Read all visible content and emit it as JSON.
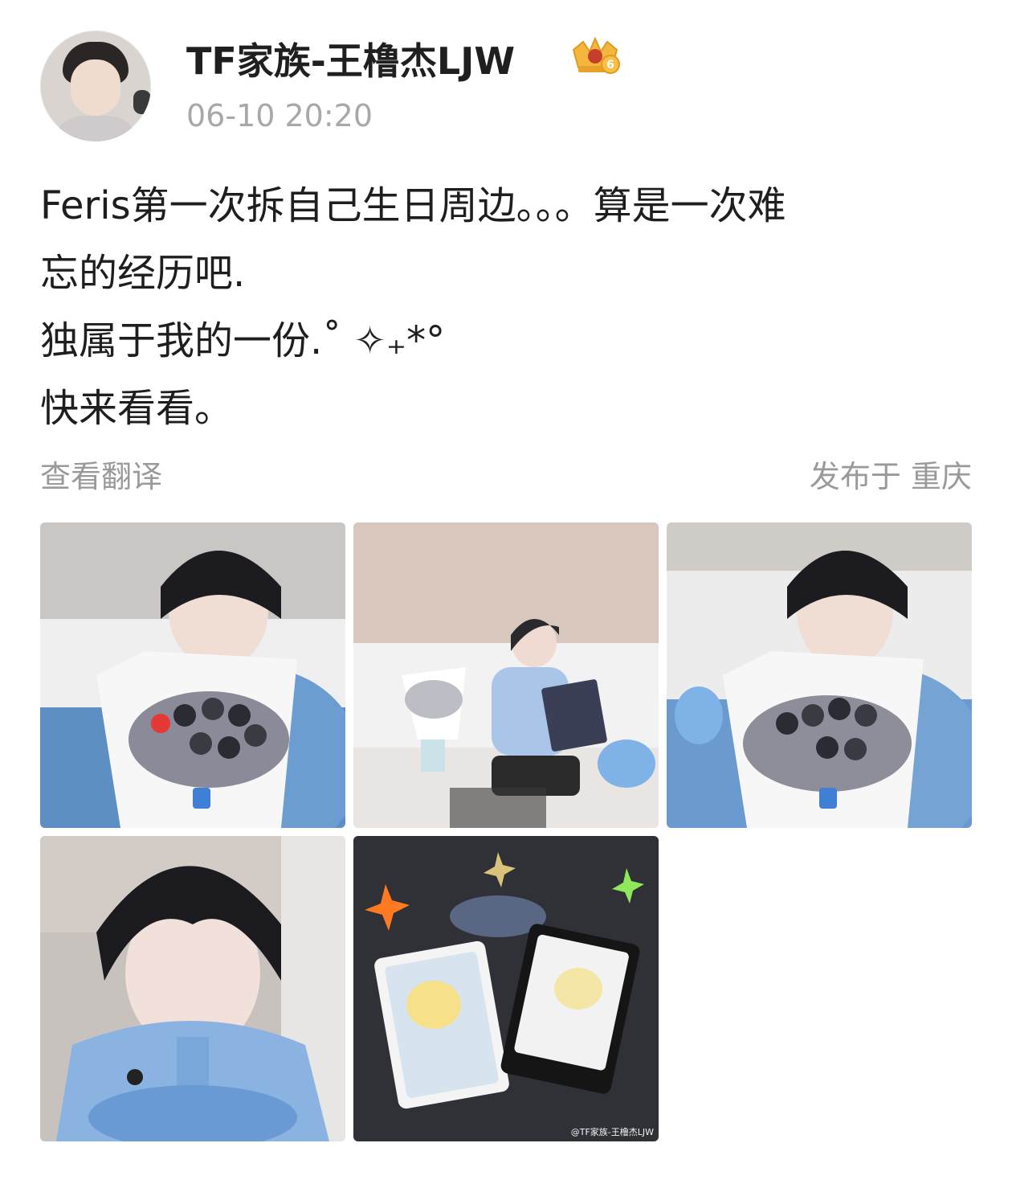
{
  "post": {
    "username": "TF家族-王橹杰LJW",
    "badge_icon": "crown-level-badge-icon",
    "badge_level": "6",
    "timestamp": "06-10 20:20",
    "text_lines": [
      "Feris第一次拆自己生日周边。。。算是一次难",
      "忘的经历吧.",
      "独属于我的一份.˚ ✧₊*°",
      "快来看看。"
    ],
    "translate_label": "查看翻译",
    "location_label": "发布于 重庆",
    "images": [
      {
        "name": "photo-bouquet-closeup"
      },
      {
        "name": "photo-sitting-on-sofa"
      },
      {
        "name": "photo-bouquet-closeup-2"
      },
      {
        "name": "photo-portrait-closeup"
      },
      {
        "name": "photo-feris-cards"
      }
    ],
    "watermark": "@TF家族-王橹杰LJW"
  },
  "colors": {
    "text": "#1e1e1e",
    "secondary": "#9a9a9a",
    "timestamp": "#a8a8a8",
    "badge_gold": "#f4b63c"
  }
}
